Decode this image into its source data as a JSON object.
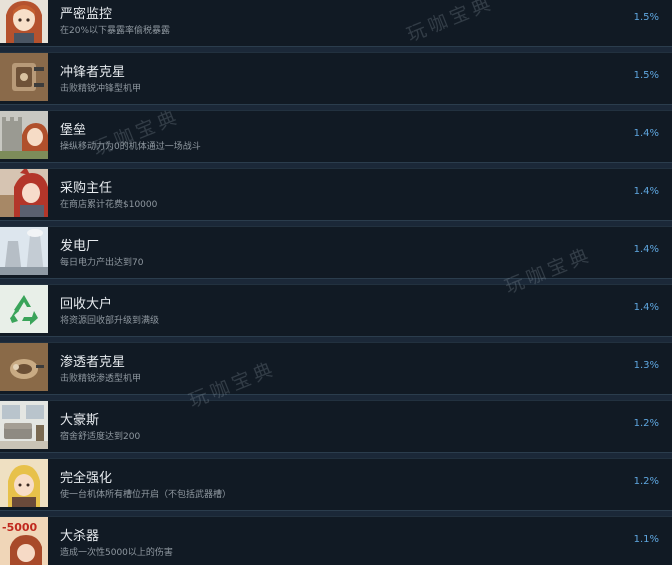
{
  "achievements": [
    {
      "title": "严密监控",
      "desc": "在20%以下暴露率偷税暴露",
      "pct": "1.5%",
      "icon": "girl-portrait-icon"
    },
    {
      "title": "冲锋者克星",
      "desc": "击败精锐冲锋型机甲",
      "pct": "1.5%",
      "icon": "mech-tank-icon"
    },
    {
      "title": "堡垒",
      "desc": "操纵移动力为0的机体通过一场战斗",
      "pct": "1.4%",
      "icon": "castle-girl-icon"
    },
    {
      "title": "采购主任",
      "desc": "在商店累计花费$10000",
      "pct": "1.4%",
      "icon": "shopper-girl-icon"
    },
    {
      "title": "发电厂",
      "desc": "每日电力产出达到70",
      "pct": "1.4%",
      "icon": "power-plant-icon"
    },
    {
      "title": "回收大户",
      "desc": "将资源回收部升级到满级",
      "pct": "1.4%",
      "icon": "recycle-icon"
    },
    {
      "title": "渗透者克星",
      "desc": "击败精锐渗透型机甲",
      "pct": "1.3%",
      "icon": "mech-infiltrator-icon"
    },
    {
      "title": "大豪斯",
      "desc": "宿舍舒适度达到200",
      "pct": "1.2%",
      "icon": "room-sofa-icon"
    },
    {
      "title": "完全强化",
      "desc": "使一台机体所有槽位开启（不包括武器槽）",
      "pct": "1.2%",
      "icon": "blonde-girl-icon"
    },
    {
      "title": "大杀器",
      "desc": "造成一次性5000以上的伤害",
      "pct": "1.1%",
      "icon": "damage-5000-icon",
      "icon_text": "-5000"
    }
  ],
  "watermark": "玩咖宝典"
}
